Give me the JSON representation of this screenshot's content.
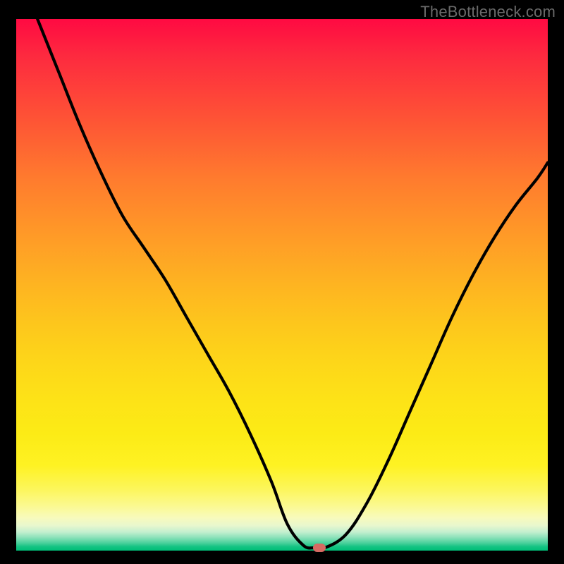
{
  "watermark": "TheBottleneck.com",
  "chart_data": {
    "type": "line",
    "title": "",
    "xlabel": "",
    "ylabel": "",
    "xlim": [
      0,
      100
    ],
    "ylim": [
      0,
      100
    ],
    "grid": false,
    "legend": false,
    "background": {
      "type": "vertical-gradient",
      "meaning": "bottleneck severity (red high, green low)",
      "stops": [
        {
          "pos": 0,
          "color": "#ff0a42"
        },
        {
          "pos": 50,
          "color": "#feb421"
        },
        {
          "pos": 85,
          "color": "#fcf65c"
        },
        {
          "pos": 100,
          "color": "#00c079"
        }
      ]
    },
    "series": [
      {
        "name": "bottleneck-curve",
        "color": "#000000",
        "x": [
          4,
          8,
          12,
          16,
          20,
          24,
          28,
          32,
          36,
          40,
          44,
          48,
          51,
          54,
          56,
          58,
          62,
          66,
          70,
          74,
          78,
          82,
          86,
          90,
          94,
          98,
          100
        ],
        "y": [
          100,
          90,
          80,
          71,
          63,
          57,
          51,
          44,
          37,
          30,
          22,
          13,
          5,
          1,
          0.5,
          0.5,
          3,
          9,
          17,
          26,
          35,
          44,
          52,
          59,
          65,
          70,
          73
        ]
      }
    ],
    "marker": {
      "name": "optimal-point",
      "x": 57,
      "y": 0.5,
      "color": "#d76a62"
    }
  }
}
